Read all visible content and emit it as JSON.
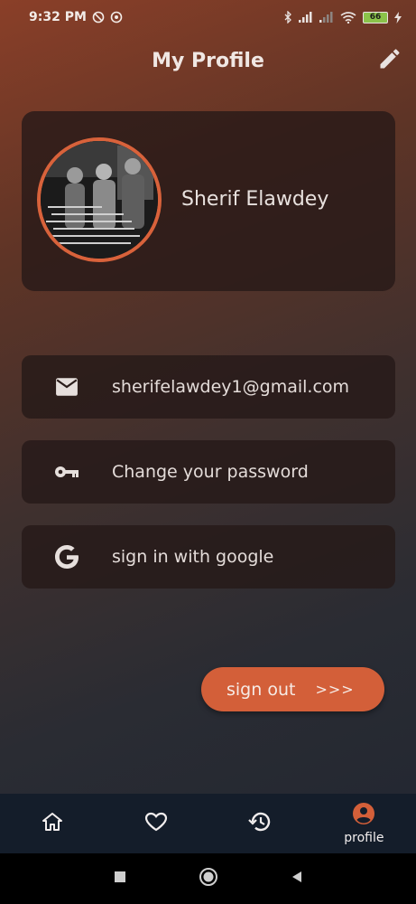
{
  "status_bar": {
    "time": "9:32 PM",
    "battery_level": "66",
    "icons": [
      "do-not-disturb-icon",
      "sync-icon",
      "bluetooth-icon",
      "signal-icon",
      "signal-icon",
      "wifi-icon",
      "battery-icon",
      "charging-icon"
    ]
  },
  "header": {
    "title": "My Profile",
    "edit_icon": "pencil-icon"
  },
  "profile": {
    "name": "Sherif Elawdey",
    "avatar_alt": "profile photo"
  },
  "items": {
    "email": {
      "icon": "mail-icon",
      "label": "sherifelawdey1@gmail.com"
    },
    "password": {
      "icon": "key-icon",
      "label": "Change your password"
    },
    "google": {
      "icon": "google-icon",
      "label": "sign in with google"
    }
  },
  "signout": {
    "label": "sign out",
    "arrows": ">>>"
  },
  "bottom_nav": {
    "items": [
      {
        "icon": "home-icon",
        "label": ""
      },
      {
        "icon": "heart-icon",
        "label": ""
      },
      {
        "icon": "history-icon",
        "label": ""
      },
      {
        "icon": "account-icon",
        "label": "profile",
        "active": true
      }
    ]
  },
  "colors": {
    "accent": "#d35f39",
    "card_bg": "#281a18",
    "nav_bg": "#141d2a"
  }
}
